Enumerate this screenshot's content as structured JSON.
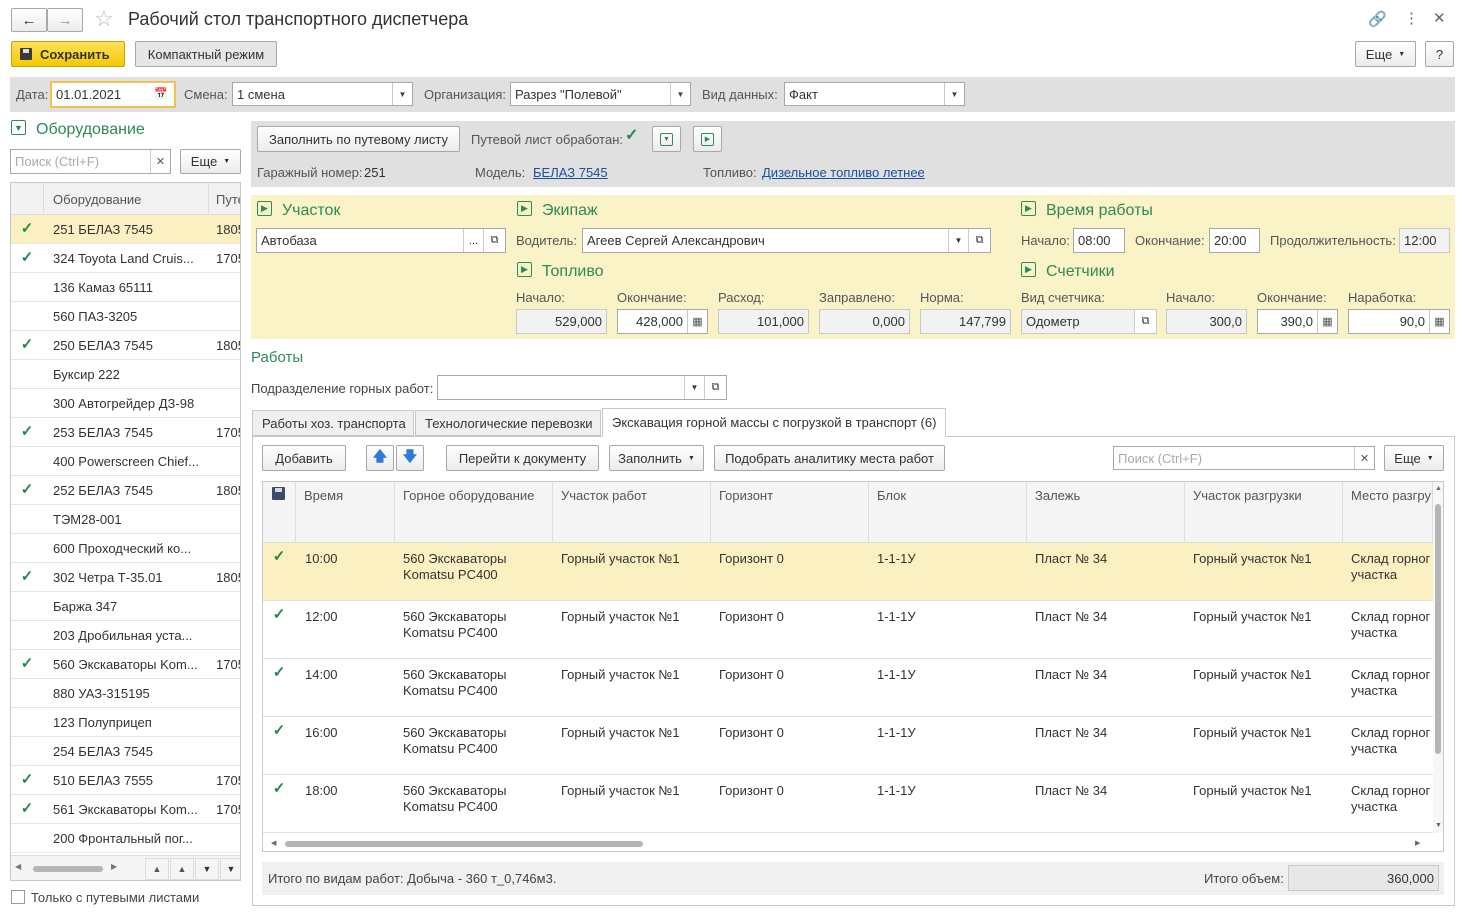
{
  "window": {
    "title": "Рабочий стол транспортного диспетчера",
    "save_label": "Сохранить",
    "compact_label": "Компактный режим",
    "more_label": "Еще",
    "help_label": "?"
  },
  "filters": {
    "date_label": "Дата:",
    "date_value": "01.01.2021",
    "shift_label": "Смена:",
    "shift_value": "1 смена",
    "org_label": "Организация:",
    "org_value": "Разрез \"Полевой\"",
    "datatype_label": "Вид данных:",
    "datatype_value": "Факт"
  },
  "equipment_panel": {
    "title": "Оборудование",
    "search_placeholder": "Поиск (Ctrl+F)",
    "more_label": "Еще",
    "col_equipment": "Оборудование",
    "col_waybill": "Путе",
    "only_waybills_label": "Только с путевыми листами",
    "items": [
      {
        "name": "251 БЕЛАЗ 7545",
        "val": "1805",
        "checked": true
      },
      {
        "name": "324 Toyota Land Cruis...",
        "val": "1705",
        "checked": true
      },
      {
        "name": "136 Камаз 65111",
        "val": "",
        "checked": false
      },
      {
        "name": "560 ПАЗ-3205",
        "val": "",
        "checked": false
      },
      {
        "name": "250 БЕЛАЗ 7545",
        "val": "1805",
        "checked": true
      },
      {
        "name": "Буксир 222",
        "val": "",
        "checked": false
      },
      {
        "name": "300 Автогрейдер ДЗ-98",
        "val": "",
        "checked": false
      },
      {
        "name": "253 БЕЛАЗ 7545",
        "val": "1705",
        "checked": true
      },
      {
        "name": "400 Powerscreen Chief...",
        "val": "",
        "checked": false
      },
      {
        "name": "252 БЕЛАЗ 7545",
        "val": "1805",
        "checked": true
      },
      {
        "name": "ТЭМ28-001",
        "val": "",
        "checked": false
      },
      {
        "name": "600 Проходческий ко...",
        "val": "",
        "checked": false
      },
      {
        "name": "302 Четра Т-35.01",
        "val": "1805",
        "checked": true
      },
      {
        "name": "Баржа 347",
        "val": "",
        "checked": false
      },
      {
        "name": "203 Дробильная уста...",
        "val": "",
        "checked": false
      },
      {
        "name": "560 Экскаваторы Kom...",
        "val": "1705",
        "checked": true
      },
      {
        "name": "880 УАЗ-315195",
        "val": "",
        "checked": false
      },
      {
        "name": "123 Полуприцеп",
        "val": "",
        "checked": false
      },
      {
        "name": "254 БЕЛАЗ 7545",
        "val": "",
        "checked": false
      },
      {
        "name": "510 БЕЛАЗ 7555",
        "val": "1705",
        "checked": true
      },
      {
        "name": "561 Экскаваторы Kom...",
        "val": "1705",
        "checked": true
      },
      {
        "name": "200 Фронтальный пог...",
        "val": "",
        "checked": false
      }
    ]
  },
  "waybill": {
    "fill_label": "Заполнить по путевому листу",
    "processed_label": "Путевой лист обработан:",
    "garage_label": "Гаражный номер:",
    "garage_value": "251",
    "model_label": "Модель:",
    "model_value": "БЕЛАЗ 7545",
    "fuel_label": "Топливо:",
    "fuel_value": "Дизельное топливо летнее"
  },
  "site": {
    "title": "Участок",
    "value": "Автобаза"
  },
  "crew": {
    "title": "Экипаж",
    "driver_label": "Водитель:",
    "driver_value": "Агеев Сергей Александрович"
  },
  "worktime": {
    "title": "Время работы",
    "start_label": "Начало:",
    "start_value": "08:00",
    "end_label": "Окончание:",
    "end_value": "20:00",
    "dur_label": "Продолжительность:",
    "dur_value": "12:00"
  },
  "fuel": {
    "title": "Топливо",
    "start_label": "Начало:",
    "start_value": "529,000",
    "end_label": "Окончание:",
    "end_value": "428,000",
    "use_label": "Расход:",
    "use_value": "101,000",
    "refill_label": "Заправлено:",
    "refill_value": "0,000",
    "norm_label": "Норма:",
    "norm_value": "147,799"
  },
  "counters": {
    "title": "Счетчики",
    "type_label": "Вид счетчика:",
    "type_value": "Одометр",
    "start_label": "Начало:",
    "start_value": "300,0",
    "end_label": "Окончание:",
    "end_value": "390,0",
    "run_label": "Наработка:",
    "run_value": "90,0"
  },
  "works": {
    "title": "Работы",
    "division_label": "Подразделение горных работ:",
    "tabs": [
      "Работы хоз. транспорта",
      "Технологические перевозки",
      "Экскавация горной массы с погрузкой в транспорт (6)"
    ],
    "add_label": "Добавить",
    "goto_label": "Перейти к документу",
    "fill_label": "Заполнить",
    "pick_label": "Подобрать аналитику места работ",
    "search_placeholder": "Поиск (Ctrl+F)",
    "more_label": "Еще",
    "columns": [
      "Время",
      "Горное оборудование",
      "Участок работ",
      "Горизонт",
      "Блок",
      "Залежь",
      "Участок разгрузки",
      "Место разгру"
    ],
    "rows": [
      {
        "time": "10:00",
        "eq1": "560 Экскаваторы",
        "eq2": "Komatsu PC400",
        "site": "Горный участок №1",
        "horizon": "Горизонт 0",
        "block": "1-1-1У",
        "deposit": "Пласт № 34",
        "unload": "Горный участок №1",
        "place1": "Склад горног",
        "place2": "участка"
      },
      {
        "time": "12:00",
        "eq1": "560 Экскаваторы",
        "eq2": "Komatsu PC400",
        "site": "Горный участок №1",
        "horizon": "Горизонт 0",
        "block": "1-1-1У",
        "deposit": "Пласт № 34",
        "unload": "Горный участок №1",
        "place1": "Склад горног",
        "place2": "участка"
      },
      {
        "time": "14:00",
        "eq1": "560 Экскаваторы",
        "eq2": "Komatsu PC400",
        "site": "Горный участок №1",
        "horizon": "Горизонт 0",
        "block": "1-1-1У",
        "deposit": "Пласт № 34",
        "unload": "Горный участок №1",
        "place1": "Склад горног",
        "place2": "участка"
      },
      {
        "time": "16:00",
        "eq1": "560 Экскаваторы",
        "eq2": "Komatsu PC400",
        "site": "Горный участок №1",
        "horizon": "Горизонт 0",
        "block": "1-1-1У",
        "deposit": "Пласт № 34",
        "unload": "Горный участок №1",
        "place1": "Склад горног",
        "place2": "участка"
      },
      {
        "time": "18:00",
        "eq1": "560 Экскаваторы",
        "eq2": "Komatsu PC400",
        "site": "Горный участок №1",
        "horizon": "Горизонт 0",
        "block": "1-1-1У",
        "deposit": "Пласт № 34",
        "unload": "Горный участок №1",
        "place1": "Склад горног",
        "place2": "участка"
      }
    ],
    "total_label": "Итого по видам работ: Добыча - 360 т_0,746м3.",
    "volume_label": "Итого объем:",
    "volume_value": "360,000"
  }
}
